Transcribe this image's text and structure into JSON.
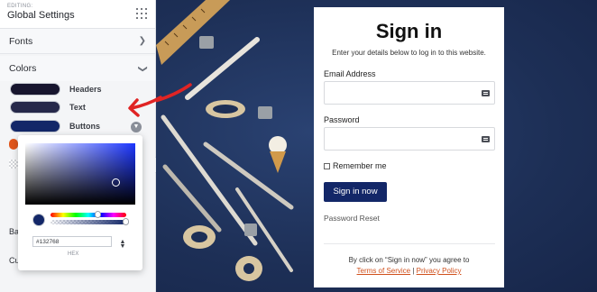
{
  "panel": {
    "eyebrow": "EDITING:",
    "title": "Global Settings",
    "fonts_label": "Fonts",
    "colors_label": "Colors",
    "swatches": [
      {
        "label": "Headers",
        "color": "#17152e"
      },
      {
        "label": "Text",
        "color": "#26284a"
      },
      {
        "label": "Buttons",
        "color": "#132768"
      }
    ],
    "clipped_rows": [
      "Ba",
      "Cu"
    ]
  },
  "picker": {
    "hex_value": "#132768",
    "hex_label": "HEX"
  },
  "signin": {
    "title": "Sign in",
    "subtitle": "Enter your details below to log in to this website.",
    "email_label": "Email Address",
    "password_label": "Password",
    "remember_label": "Remember me",
    "button_label": "Sign in now",
    "reset_link": "Password Reset",
    "footer_prefix": "By click on “Sign in now” you agree to",
    "terms_link": "Terms of Service",
    "separator": " | ",
    "privacy_link": "Privacy Policy"
  },
  "colors": {
    "accent": "#132768",
    "arrow": "#e02424",
    "link": "#d0501c"
  }
}
